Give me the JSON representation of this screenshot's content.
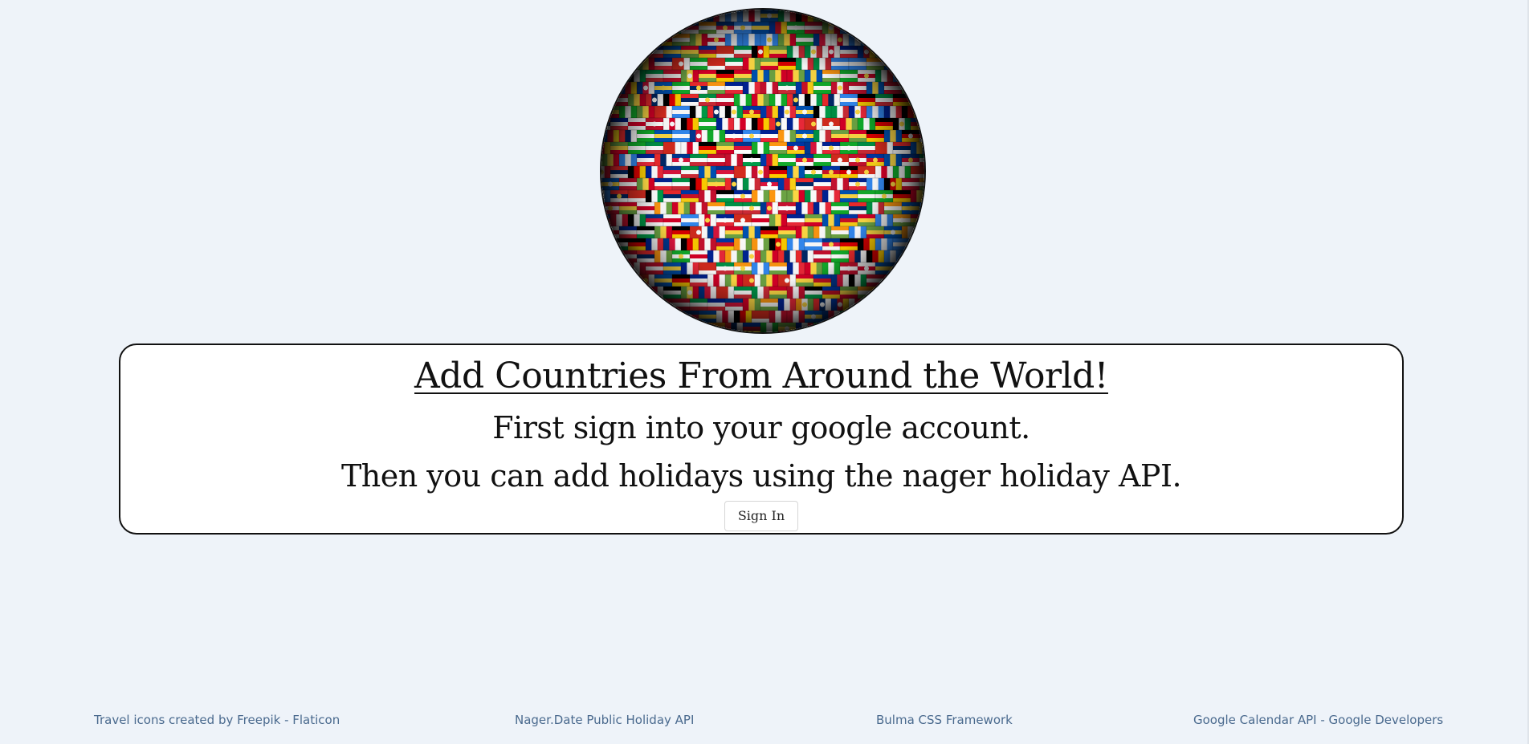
{
  "hero": {
    "globe_image": "flags-of-the-world-globe"
  },
  "card": {
    "title": "Add Countries From Around the World!",
    "line_1": "First sign into your google account.",
    "line_2": "Then you can add holidays using the nager holiday API.",
    "sign_in_label": "Sign In"
  },
  "footer": {
    "links": [
      {
        "label": "Travel icons created by Freepik - Flaticon"
      },
      {
        "label": "Nager.Date Public Holiday API"
      },
      {
        "label": "Bulma CSS Framework"
      },
      {
        "label": "Google Calendar API - Google Developers"
      }
    ]
  },
  "colors": {
    "page_background": "#eef3f9",
    "card_background": "#ffffff",
    "card_border": "#111111",
    "footer_link": "#4a6a8e"
  }
}
